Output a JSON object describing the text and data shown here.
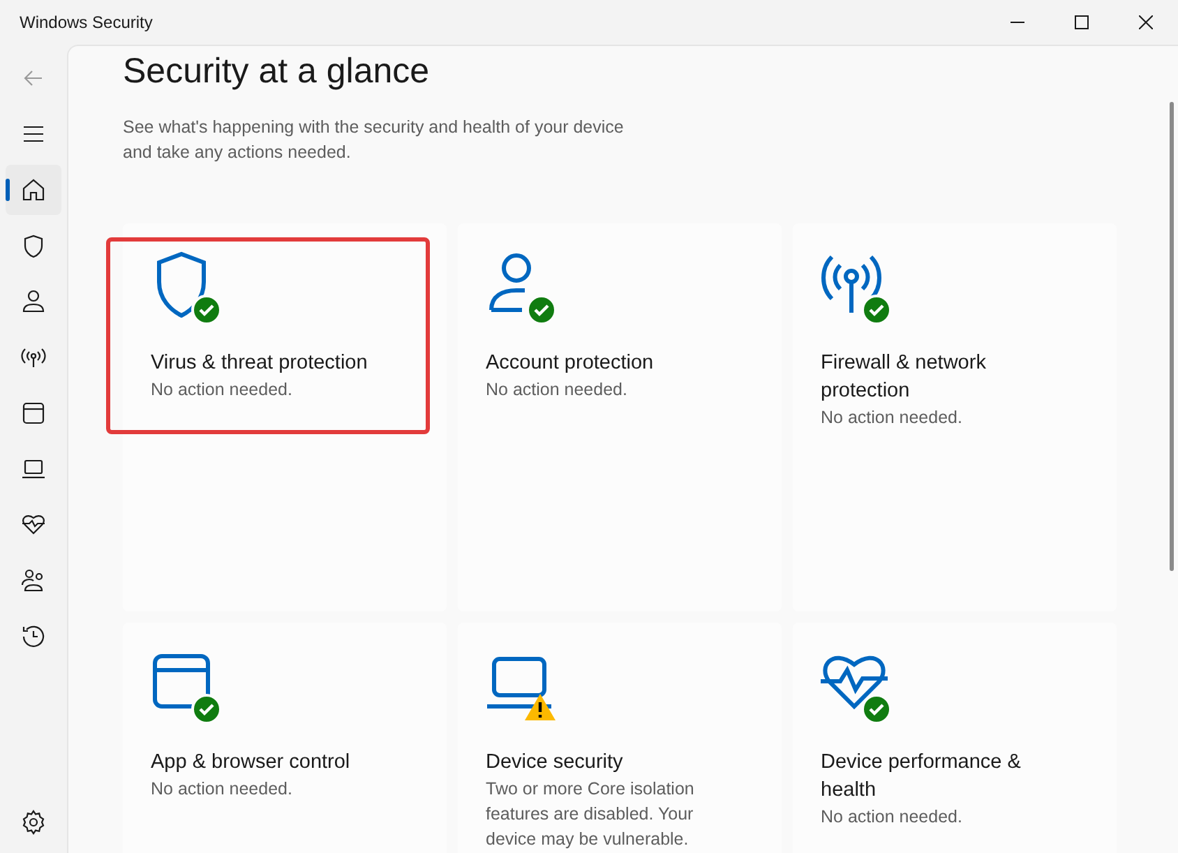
{
  "window": {
    "title": "Windows Security"
  },
  "sidebar": {
    "items": [
      {
        "selected": true
      },
      {
        "selected": false
      },
      {
        "selected": false
      },
      {
        "selected": false
      },
      {
        "selected": false
      },
      {
        "selected": false
      },
      {
        "selected": false
      },
      {
        "selected": false
      },
      {
        "selected": false
      }
    ]
  },
  "page": {
    "title": "Security at a glance",
    "description": "See what's happening with the security and health of your device and take any actions needed."
  },
  "cards": [
    {
      "title": "Virus & threat protection",
      "status_text": "No action needed.",
      "kind": "ok",
      "highlighted": true
    },
    {
      "title": "Account protection",
      "status_text": "No action needed.",
      "kind": "ok",
      "highlighted": false
    },
    {
      "title": "Firewall & network protection",
      "status_text": "No action needed.",
      "kind": "ok",
      "highlighted": false
    },
    {
      "title": "App & browser control",
      "status_text": "No action needed.",
      "kind": "ok",
      "highlighted": false
    },
    {
      "title": "Device security",
      "status_text": "Two or more Core isolation features are disabled.  Your device may be vulnerable.",
      "kind": "warning",
      "highlighted": false
    },
    {
      "title": "Device performance & health",
      "status_text": "No action needed.",
      "kind": "ok",
      "highlighted": false
    }
  ]
}
